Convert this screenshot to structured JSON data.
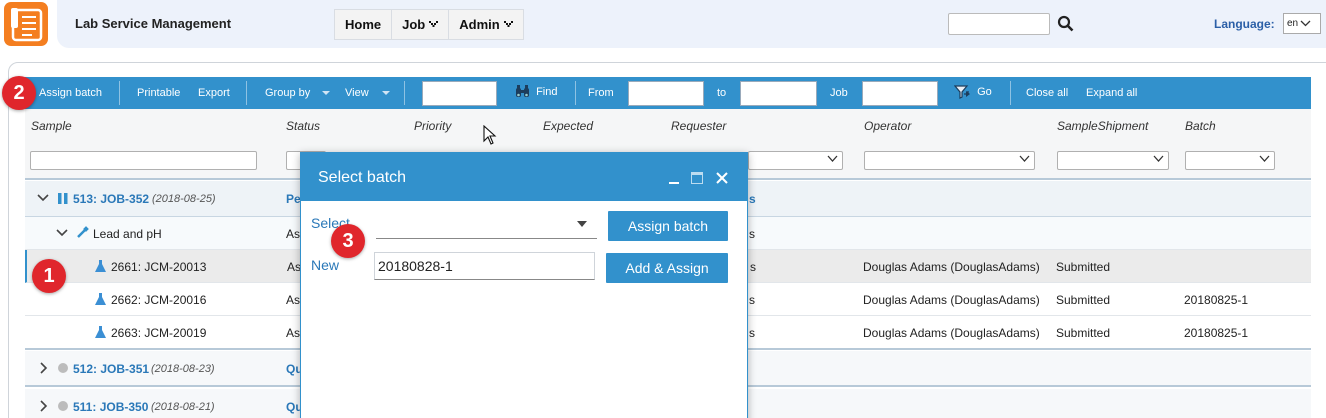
{
  "header": {
    "app_title": "Lab Service Management",
    "nav": [
      {
        "label": "Home",
        "has_menu": false
      },
      {
        "label": "Job",
        "has_menu": true
      },
      {
        "label": "Admin",
        "has_menu": true
      }
    ],
    "search": {
      "value": "",
      "placeholder": ""
    },
    "language_label": "Language:",
    "language_value": "en"
  },
  "toolbar": {
    "assign_batch": "Assign batch",
    "printable": "Printable",
    "export": "Export",
    "group_by": "Group by",
    "view": "View",
    "find": "Find",
    "from": "From",
    "to": "to",
    "job": "Job",
    "go": "Go",
    "close_all": "Close all",
    "expand_all": "Expand all"
  },
  "columns": [
    "Sample",
    "Status",
    "Priority",
    "Expected",
    "Requester",
    "Operator",
    "SampleShipment",
    "Batch"
  ],
  "rows": {
    "group1": {
      "title": "513: JOB-352",
      "date": "(2018-08-25)",
      "status": "Pe",
      "requester_tail": "s"
    },
    "subgroup": {
      "title": "Lead and pH",
      "status": "As",
      "requester_tail": "s"
    },
    "samples": [
      {
        "id": "2661: JCM-20013",
        "status": "As",
        "requester_tail": "s",
        "operator": "Douglas Adams (DouglasAdams)",
        "shipment": "Submitted",
        "batch": ""
      },
      {
        "id": "2662: JCM-20016",
        "status": "As",
        "requester_tail": "s",
        "operator": "Douglas Adams (DouglasAdams)",
        "shipment": "Submitted",
        "batch": "20180825-1"
      },
      {
        "id": "2663: JCM-20019",
        "status": "As",
        "requester_tail": "s",
        "operator": "Douglas Adams (DouglasAdams)",
        "shipment": "Submitted",
        "batch": "20180825-1"
      }
    ],
    "group2": {
      "title": "512: JOB-351",
      "date": "(2018-08-23)",
      "status": "Qu"
    },
    "group3": {
      "title": "511: JOB-350",
      "date": "(2018-08-21)",
      "status": "Qu"
    }
  },
  "dialog": {
    "title": "Select batch",
    "select_label": "Select",
    "select_value": "",
    "assign_button": "Assign batch",
    "new_label": "New",
    "new_value": "20180828-1",
    "add_assign_button": "Add & Assign"
  },
  "badges": [
    "1",
    "2",
    "3"
  ],
  "colors": {
    "accent": "#3291cc",
    "brand": "#f47e20",
    "badge": "#e0262c",
    "link": "#2a78b8"
  }
}
